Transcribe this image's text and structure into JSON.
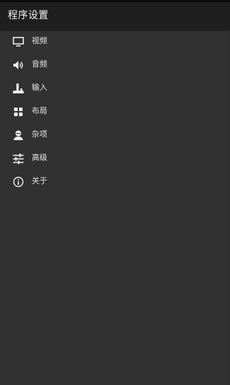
{
  "header": {
    "title": "程序设置"
  },
  "menu": {
    "items": [
      {
        "label": "视频",
        "icon": "monitor-icon"
      },
      {
        "label": "音频",
        "icon": "speaker-icon"
      },
      {
        "label": "输入",
        "icon": "joystick-icon"
      },
      {
        "label": "布局",
        "icon": "grid-icon"
      },
      {
        "label": "杂项",
        "icon": "person-icon"
      },
      {
        "label": "高级",
        "icon": "sliders-icon"
      },
      {
        "label": "关于",
        "icon": "info-icon"
      }
    ]
  },
  "colors": {
    "background": "#313131",
    "header_background": "#1f1f1f",
    "text": "#e6e6e6",
    "icon": "#f0f0f0"
  }
}
